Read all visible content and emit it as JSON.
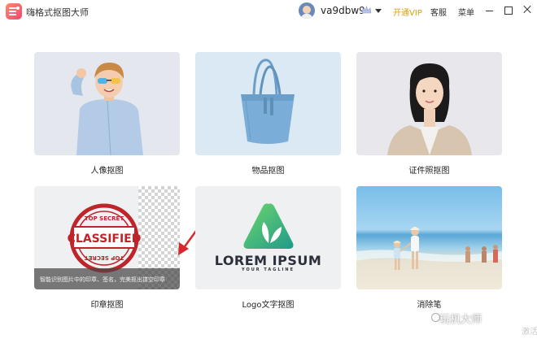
{
  "app": {
    "title": "嗨格式抠图大师"
  },
  "header": {
    "username": "va9dbw9",
    "open_vip": "开通VIP",
    "service": "客服",
    "menu": "菜单"
  },
  "cards": [
    {
      "label": "人像抠图"
    },
    {
      "label": "物品抠图"
    },
    {
      "label": "证件照抠图"
    },
    {
      "label": "印章抠图",
      "caption": "智能识别图片中的印章、签名，完美抠出镂空印章"
    },
    {
      "label": "Logo文字抠图",
      "logo_text": "LOREM IPSUM",
      "logo_tagline": "YOUR TAGLINE"
    },
    {
      "label": "消除笔"
    }
  ],
  "stamp": {
    "line1": "TOP SECRET",
    "center": "CLASSIFIED",
    "line2": "TOP SECRET"
  },
  "watermark": {
    "text": "玩机大师",
    "sub": "激活"
  },
  "colors": {
    "vip": "#d6a114",
    "stamp_red": "#c0242b",
    "arrow_red": "#d9272e",
    "logo_green": "#3bb36a"
  }
}
